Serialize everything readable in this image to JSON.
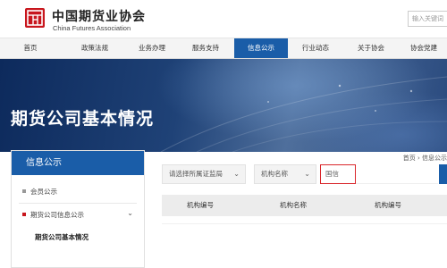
{
  "header": {
    "logo_cn": "中国期货业协会",
    "logo_en": "China Futures Association",
    "search_placeholder": "输入关键词"
  },
  "nav": {
    "items": [
      {
        "label": "首页"
      },
      {
        "label": "政策法规"
      },
      {
        "label": "业务办理"
      },
      {
        "label": "服务支持"
      },
      {
        "label": "信息公示"
      },
      {
        "label": "行业动态"
      },
      {
        "label": "关于协会"
      },
      {
        "label": "协会党建"
      }
    ],
    "active_index": 4
  },
  "banner": {
    "title": "期货公司基本情况"
  },
  "breadcrumb": "首页 › 信息公示",
  "sidebar": {
    "title": "信息公示",
    "items": [
      {
        "label": "会员公示"
      },
      {
        "label": "期货公司信息公示"
      },
      {
        "label": "期货公司基本情况"
      }
    ]
  },
  "filters": {
    "regulator_select": "请选择所属证监局",
    "field_select": "机构名称",
    "name_input_value": "国信"
  },
  "table": {
    "columns": [
      "机构编号",
      "机构名称",
      "机构编号"
    ]
  },
  "colors": {
    "brand_red": "#c8161d",
    "nav_active": "#1a5da8",
    "highlight_border": "#d9262b"
  }
}
